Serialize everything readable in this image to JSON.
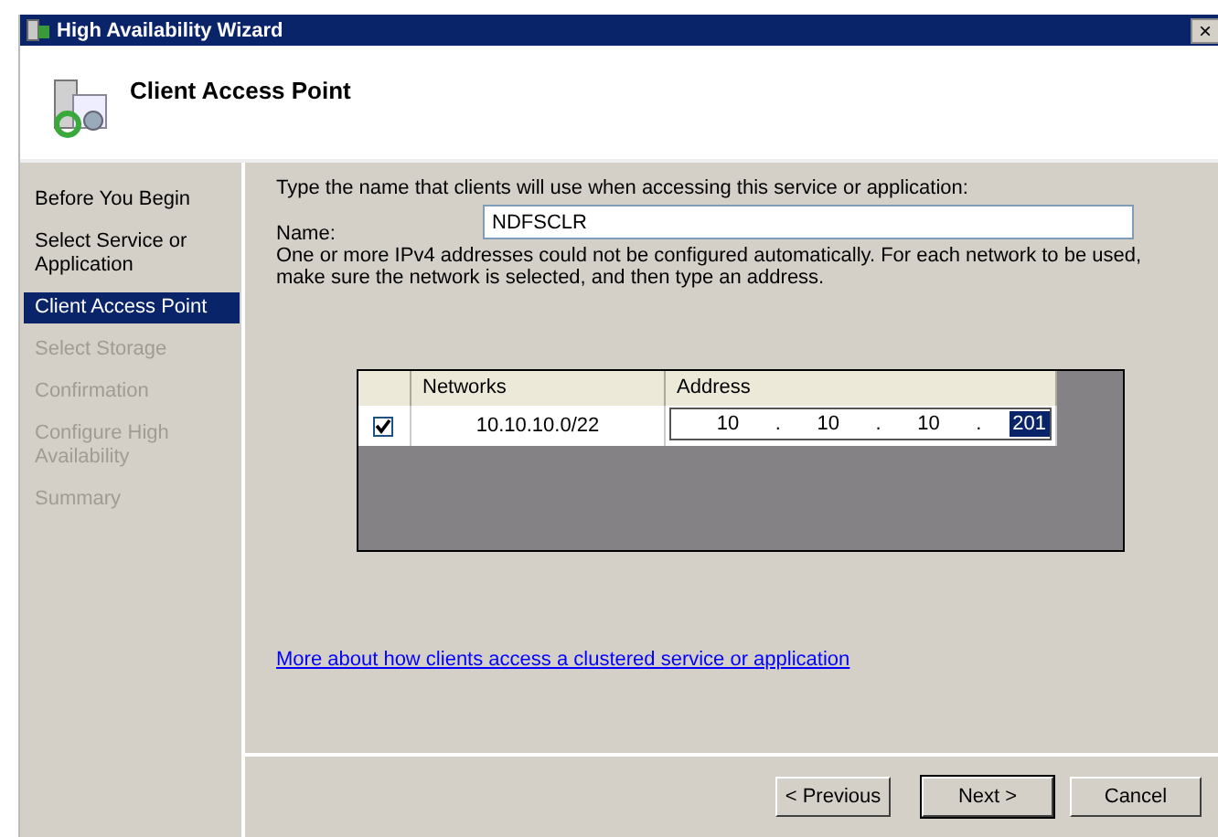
{
  "window": {
    "title": "High Availability Wizard",
    "close": "×"
  },
  "header": {
    "title": "Client Access Point"
  },
  "steps": [
    {
      "label": "Before You Begin",
      "selected": false,
      "disabled": false
    },
    {
      "label": "Select Service or Application",
      "selected": false,
      "disabled": false
    },
    {
      "label": "Client Access Point",
      "selected": true,
      "disabled": false
    },
    {
      "label": "Select Storage",
      "selected": false,
      "disabled": true
    },
    {
      "label": "Confirmation",
      "selected": false,
      "disabled": true
    },
    {
      "label": "Configure High Availability",
      "selected": false,
      "disabled": true
    },
    {
      "label": "Summary",
      "selected": false,
      "disabled": true
    }
  ],
  "instruction": "Type the name that clients will use when accessing this service or application:",
  "name_field": {
    "label": "Name:",
    "value": "NDFSCLR"
  },
  "info": "One or more IPv4 addresses could not be configured automatically.  For each network to be used, make sure the network is selected, and then type an address.",
  "networks_table": {
    "columns": [
      "Networks",
      "Address"
    ],
    "rows": [
      {
        "checked": true,
        "network": "10.10.10.0/22",
        "address": [
          {
            "value": "10",
            "selected": false
          },
          {
            "value": "10",
            "selected": false
          },
          {
            "value": "10",
            "selected": false
          },
          {
            "value": "201",
            "selected": true
          }
        ],
        "separator": "."
      }
    ]
  },
  "link": "More about how clients access a clustered service or application",
  "buttons": [
    {
      "label": "< Previous",
      "default": false
    },
    {
      "label": "Next >",
      "default": true
    },
    {
      "label": "Cancel",
      "default": false
    }
  ]
}
